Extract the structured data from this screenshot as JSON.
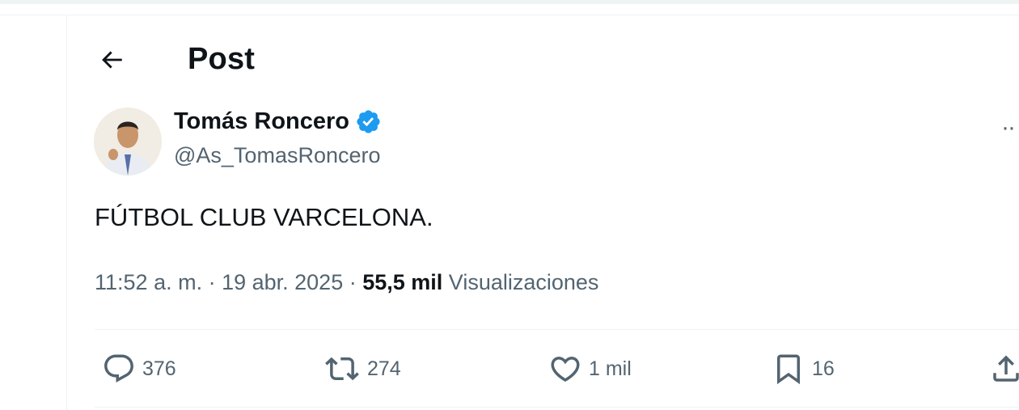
{
  "header": {
    "title": "Post",
    "back_icon": "arrow-left-icon"
  },
  "author": {
    "name": "Tomás Roncero",
    "handle": "@As_TomasRoncero",
    "verified_color": "#1d9bf0"
  },
  "post": {
    "text": "FÚTBOL CLUB VARCELONA.",
    "time": "11:52 a. m.",
    "date": "19 abr. 2025",
    "views_count": "55,5 mil",
    "views_label": "Visualizaciones"
  },
  "actions": {
    "replies": "376",
    "reposts": "274",
    "likes": "1 mil",
    "bookmarks": "16"
  },
  "colors": {
    "text": "#0f1419",
    "secondary": "#536471",
    "border": "#eff3f4",
    "accent": "#1d9bf0"
  }
}
